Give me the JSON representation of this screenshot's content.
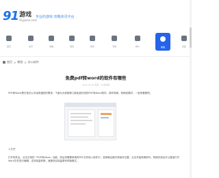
{
  "header": {
    "logo_number": "91",
    "logo_cn": "游戏",
    "logo_domain": "91game.com",
    "slogan": "专业的游戏 攻略资讯平台"
  },
  "nav": {
    "items": [
      {
        "label": "首页",
        "icon": "home-icon"
      },
      {
        "label": "资讯",
        "icon": "news-icon"
      },
      {
        "label": "攻略",
        "icon": "guide-icon"
      },
      {
        "label": "游戏",
        "icon": "gamepad-icon"
      },
      {
        "label": "软件",
        "icon": "app-icon"
      },
      {
        "label": "专题",
        "icon": "topic-icon"
      },
      {
        "label": "排行",
        "icon": "rank-icon"
      },
      {
        "label": "教程",
        "icon": "tutorial-icon"
      },
      {
        "label": "合集",
        "icon": "collection-icon"
      }
    ],
    "active_index": 7
  },
  "breadcrumb": {
    "items": [
      "首页",
      ">",
      "教程",
      ">",
      "办公软件"
    ]
  },
  "article": {
    "title": "免费pdf转word的软件有哪些",
    "meta": "2024-05-20  来源：91游戏网",
    "intro": "PDF转Word是日常办公中经常遇到的需求，下面为大家推荐几款免费好用的PDF转Word软件，操作简单，转换效果好，一起来看看吧。",
    "step_label": "1.打开",
    "body": "打开软件后，点击左侧的「PDF转Word」功能，然后将需要转换的PDF文件拖入软件中，选择输出格式和保存位置，点击开始转换即可。转换完成后可以直接打开Word文件进行编辑，支持批量转换，速度快且保留原有排版格式。"
  },
  "colors": {
    "accent": "#2563eb",
    "logo": "#1a73e8"
  }
}
